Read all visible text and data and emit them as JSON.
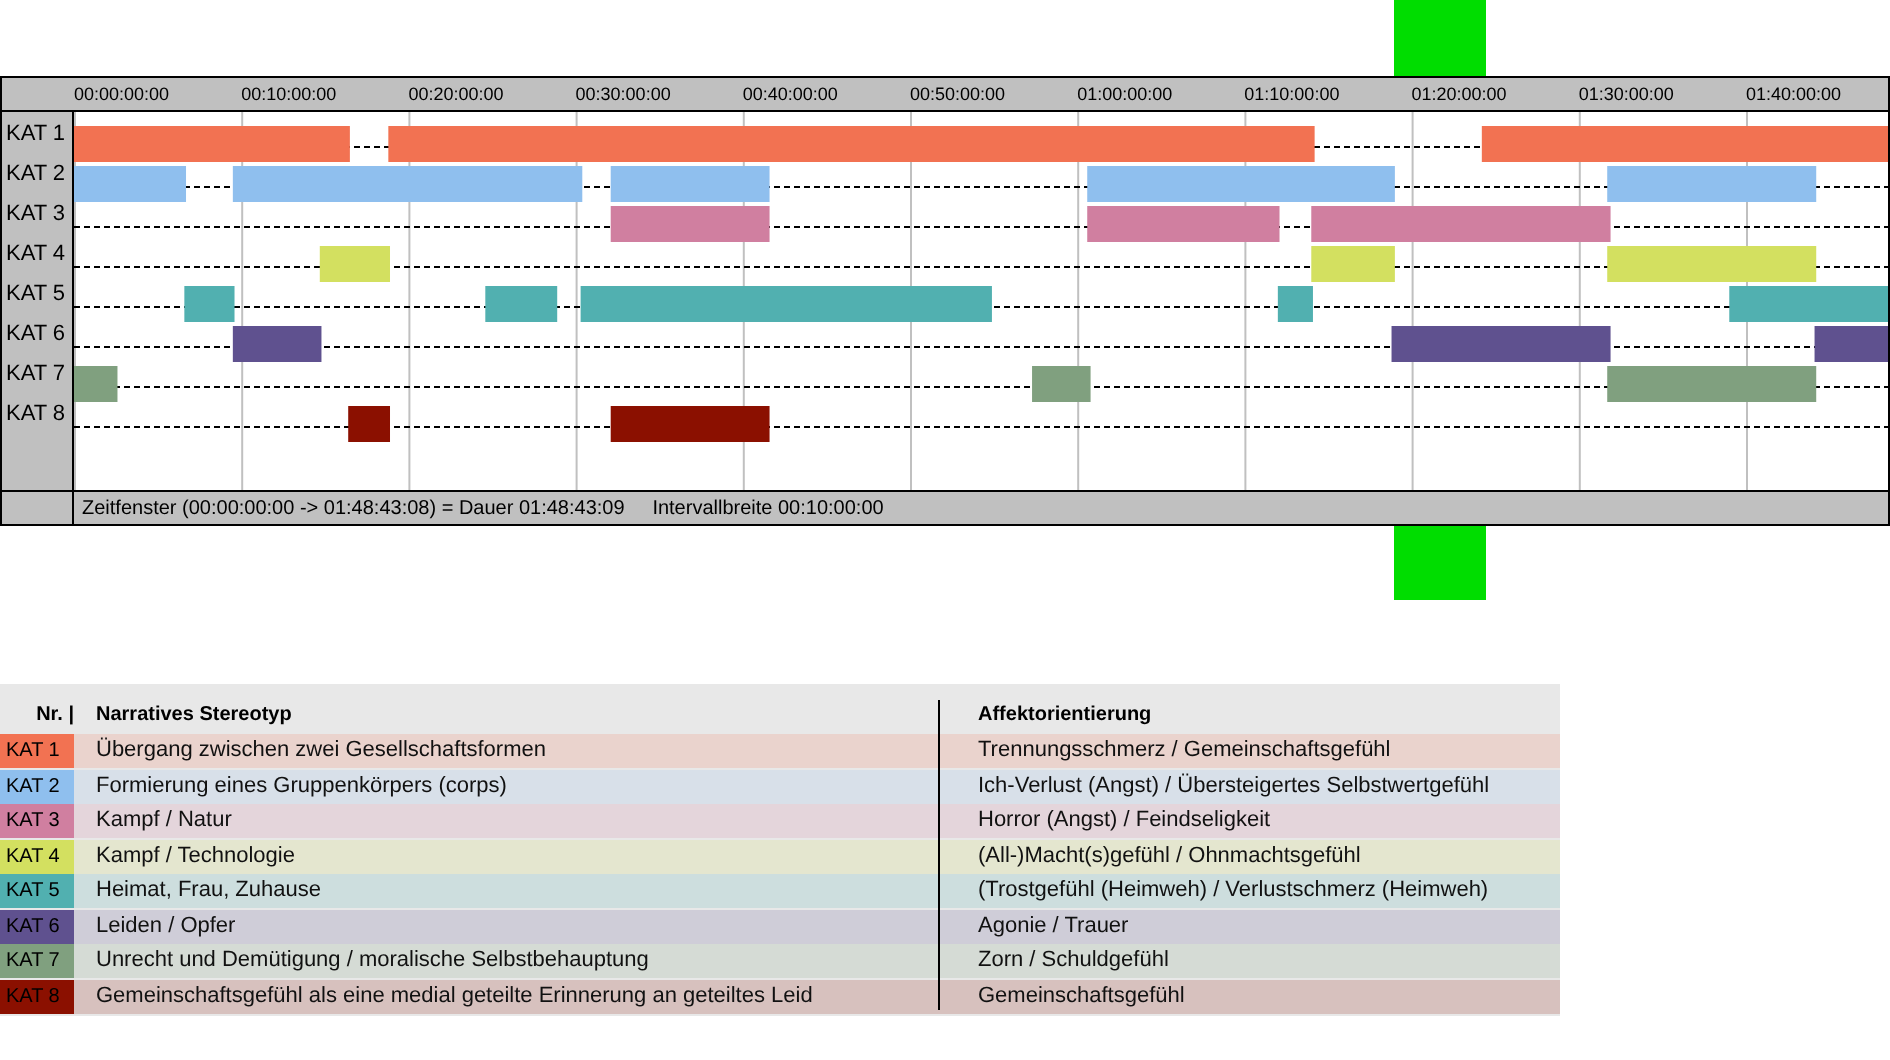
{
  "timeline": {
    "time_labels": [
      "00:00:00:00",
      "00:10:00:00",
      "00:20:00:00",
      "00:30:00:00",
      "00:40:00:00",
      "00:50:00:00",
      "01:00:00:00",
      "01:10:00:00",
      "01:20:00:00",
      "01:30:00:00",
      "01:40:00:00"
    ],
    "rows": [
      {
        "label": "KAT 1",
        "color": "#f27252"
      },
      {
        "label": "KAT 2",
        "color": "#8fbfee"
      },
      {
        "label": "KAT 3",
        "color": "#d07fa0"
      },
      {
        "label": "KAT 4",
        "color": "#d3e060"
      },
      {
        "label": "KAT 5",
        "color": "#51b0b0"
      },
      {
        "label": "KAT 6",
        "color": "#5f518f"
      },
      {
        "label": "KAT 7",
        "color": "#80a07f"
      },
      {
        "label": "KAT 8",
        "color": "#8b1000"
      }
    ],
    "status": "Zeitfenster (00:00:00:00 -> 01:48:43:08) = Dauer 01:48:43:09     Intervallbreite 00:10:00:00"
  },
  "legend": {
    "columns": [
      "Nr. |",
      "Narratives Stereotyp",
      "Affektorientierung"
    ],
    "rows": [
      {
        "nr": "KAT 1",
        "color": "#f27252",
        "stereotype": "Übergang zwischen zwei Gesellschaftsformen",
        "affect": "Trennungsschmerz / Gemeinschaftsgefühl"
      },
      {
        "nr": "KAT 2",
        "color": "#8fbfee",
        "stereotype": "Formierung eines Gruppenkörpers (corps)",
        "affect": "Ich-Verlust (Angst) / Übersteigertes Selbstwertgefühl"
      },
      {
        "nr": "KAT 3",
        "color": "#d07fa0",
        "stereotype": "Kampf / Natur",
        "affect": "Horror (Angst) / Feindseligkeit"
      },
      {
        "nr": "KAT 4",
        "color": "#d3e060",
        "stereotype": "Kampf / Technologie",
        "affect": "(All-)Macht(s)gefühl / Ohnmachtsgefühl"
      },
      {
        "nr": "KAT 5",
        "color": "#51b0b0",
        "stereotype": "Heimat, Frau, Zuhause",
        "affect": "(Trostgefühl (Heimweh) / Verlustschmerz (Heimweh)"
      },
      {
        "nr": "KAT 6",
        "color": "#5f518f",
        "stereotype": "Leiden / Opfer",
        "affect": "Agonie / Trauer"
      },
      {
        "nr": "KAT 7",
        "color": "#80a07f",
        "stereotype": "Unrecht und Demütigung / moralische Selbstbehauptung",
        "affect": "Zorn / Schuldgefühl"
      },
      {
        "nr": "KAT 8",
        "color": "#8b1000",
        "stereotype": "Gemeinschaftsgefühl als eine medial geteilte Erinnerung an geteiltes Leid",
        "affect": "Gemeinschaftsgefühl"
      }
    ]
  }
}
